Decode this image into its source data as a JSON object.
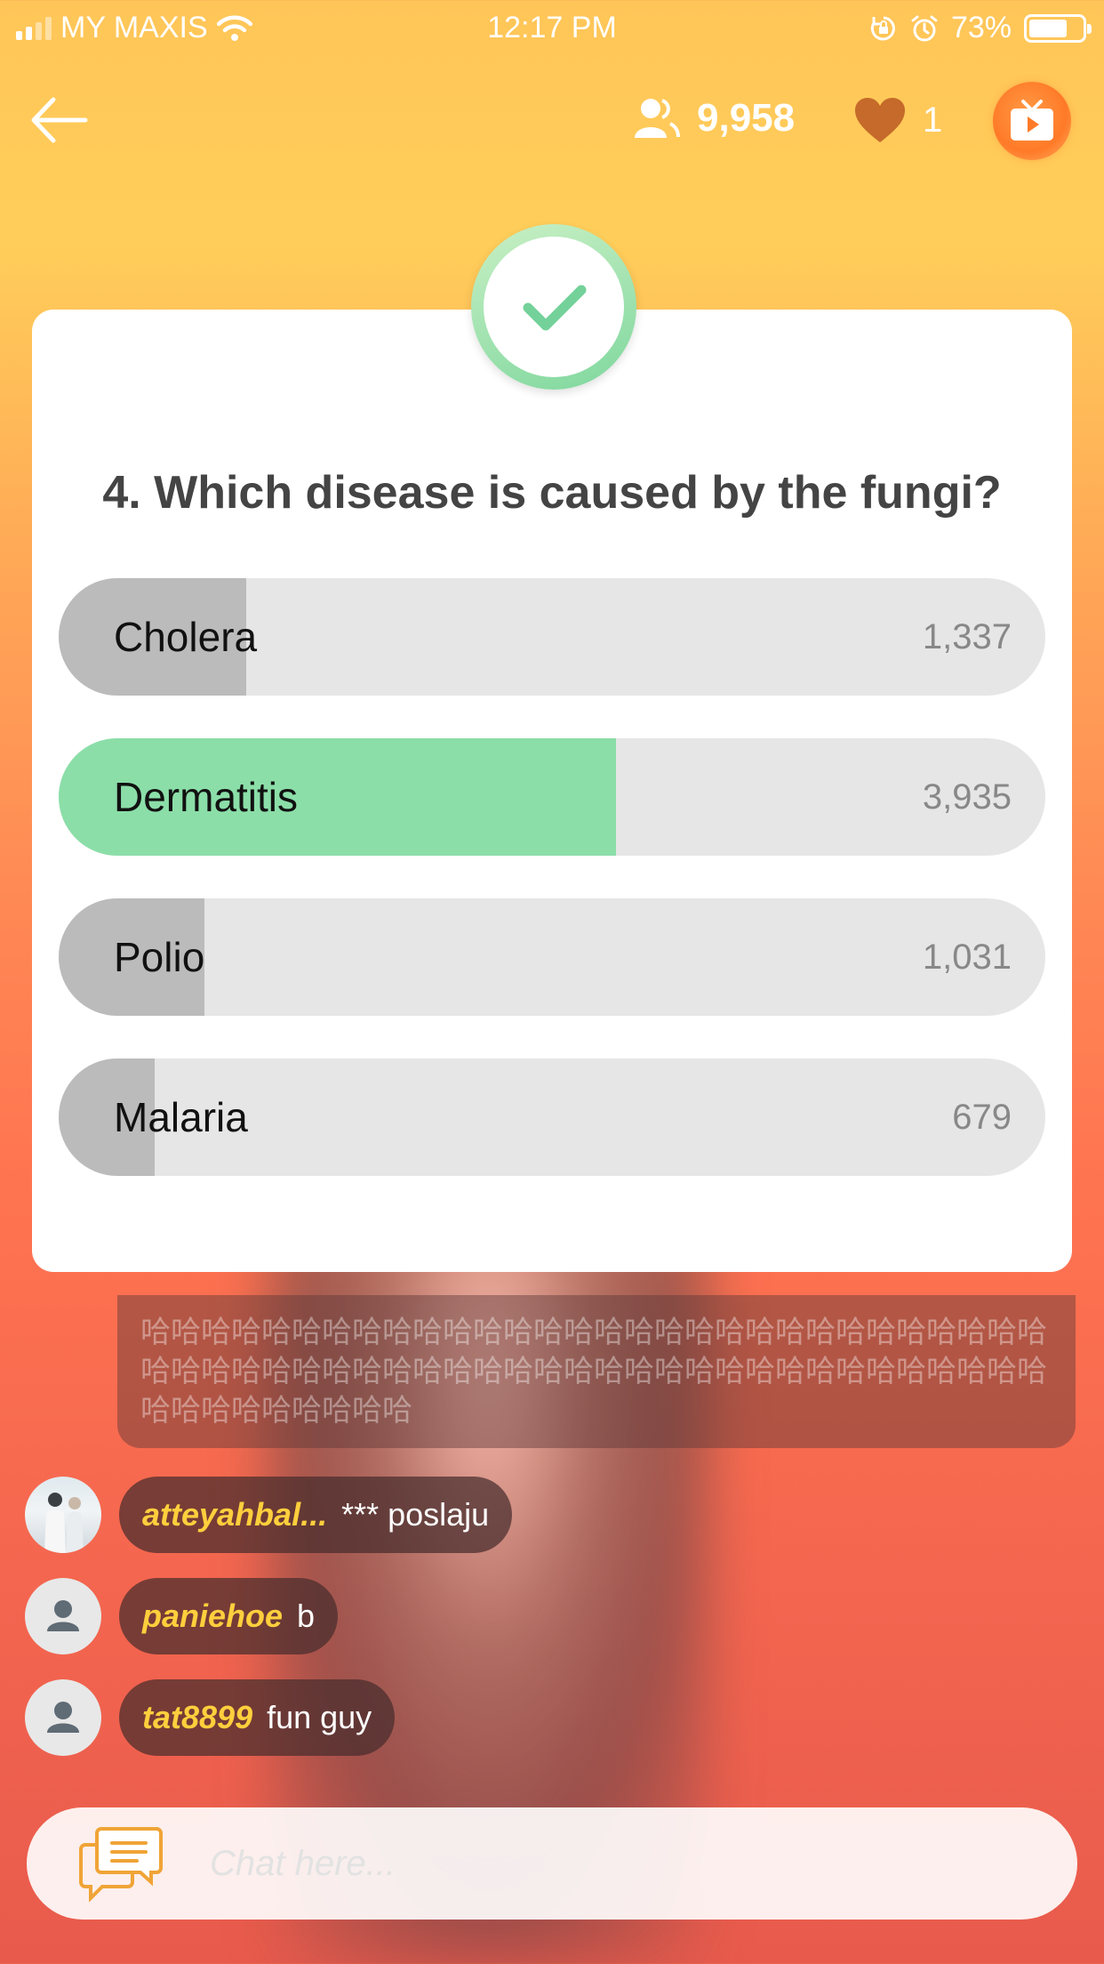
{
  "status_bar": {
    "carrier": "MY MAXIS",
    "time": "12:17 PM",
    "battery": "73%",
    "battery_level": 0.73
  },
  "header": {
    "viewer_count": "9,958",
    "lives": "1",
    "icons": [
      "back-arrow-icon",
      "viewers-icon",
      "heart-icon",
      "tv-play-icon"
    ]
  },
  "quiz": {
    "question": "4. Which disease is caused by the fungi?",
    "result_icon": "check-icon",
    "options": [
      {
        "label": "Cholera",
        "count": "1,337",
        "fraction": 0.19,
        "correct": false
      },
      {
        "label": "Dermatitis",
        "count": "3,935",
        "fraction": 0.565,
        "correct": true
      },
      {
        "label": "Polio",
        "count": "1,031",
        "fraction": 0.148,
        "correct": false
      },
      {
        "label": "Malaria",
        "count": "679",
        "fraction": 0.097,
        "correct": false
      }
    ],
    "colors": {
      "correct": "#8bdea8",
      "other": "#bbbbbb",
      "track": "#e6e6e6"
    }
  },
  "chat": {
    "flood_text": "哈哈哈哈哈哈哈哈哈哈哈哈哈哈哈哈哈哈哈哈哈哈哈哈哈哈哈哈哈哈哈哈哈哈哈哈哈哈哈哈哈哈哈哈哈哈哈哈哈哈哈哈哈哈哈哈哈哈哈哈哈哈哈哈哈哈哈哈哈",
    "messages": [
      {
        "user": "atteyahbal...",
        "text": "*** poslaju",
        "avatar": "photo"
      },
      {
        "user": "paniehoe",
        "text": "b",
        "avatar": "default-user-icon"
      },
      {
        "user": "tat8899",
        "text": "fun guy",
        "avatar": "default-user-icon"
      }
    ],
    "input_placeholder": "Chat here..."
  }
}
